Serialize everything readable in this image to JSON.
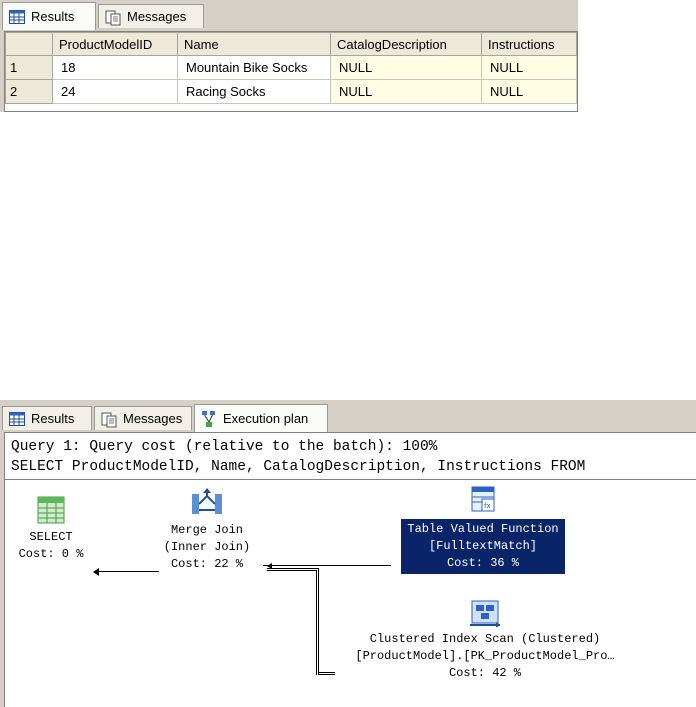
{
  "results_panel": {
    "tabs": [
      {
        "label": "Results",
        "icon": "grid-icon",
        "active": true
      },
      {
        "label": "Messages",
        "icon": "messages-icon",
        "active": false
      }
    ],
    "columns": [
      "ProductModelID",
      "Name",
      "CatalogDescription",
      "Instructions"
    ],
    "rows": [
      {
        "num": "1",
        "cells": [
          "18",
          "Mountain Bike Socks",
          "NULL",
          "NULL"
        ]
      },
      {
        "num": "2",
        "cells": [
          "24",
          "Racing Socks",
          "NULL",
          "NULL"
        ]
      }
    ]
  },
  "plan_panel": {
    "tabs": [
      {
        "label": "Results",
        "icon": "grid-icon",
        "active": false
      },
      {
        "label": "Messages",
        "icon": "messages-icon",
        "active": false
      },
      {
        "label": "Execution plan",
        "icon": "execution-plan-icon",
        "active": true
      }
    ],
    "query_line1": "Query 1: Query cost (relative to the batch): 100%",
    "query_line2": "SELECT ProductModelID, Name, CatalogDescription, Instructions FROM",
    "nodes": {
      "select": {
        "line1": "SELECT",
        "line2": "Cost: 0 %"
      },
      "merge_join": {
        "line1": "Merge Join",
        "line2": "(Inner Join)",
        "line3": "Cost: 22 %"
      },
      "tvf": {
        "line1": "Table Valued Function",
        "line2": "[FulltextMatch]",
        "line3": "Cost: 36 %"
      },
      "scan": {
        "line1": "Clustered Index Scan (Clustered)",
        "line2": "[ProductModel].[PK_ProductModel_Pro…",
        "line3": "Cost: 42 %"
      }
    }
  },
  "colors": {
    "selection": "#0a246a",
    "null_cell": "#fffde3",
    "chrome": "#d4d0c8"
  }
}
